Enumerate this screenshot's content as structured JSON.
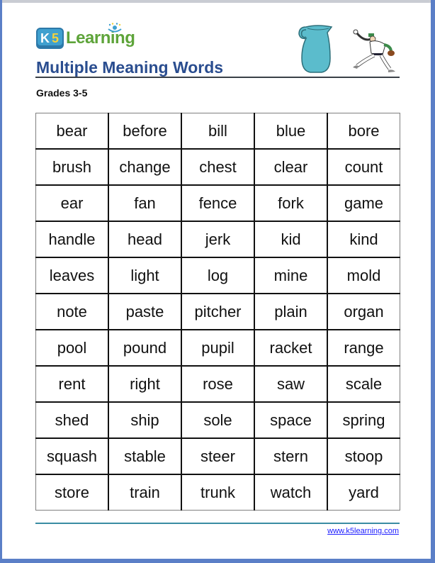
{
  "header": {
    "logo": {
      "badge_letters": "K",
      "badge_number": "5",
      "text": "Learning"
    },
    "title": "Multiple Meaning Words",
    "subtitle": "Grades 3-5",
    "illustrations": [
      "pitcher-jug-icon",
      "baseball-pitcher-icon"
    ]
  },
  "colors": {
    "title": "#2a4d8f",
    "logo_green": "#5ea43a",
    "logo_blue": "#3fa0cf",
    "pitcher_fill": "#5bbccc",
    "footer_rule": "#3a8ca3",
    "link": "#1a1aff",
    "frame": "#5b7fc7"
  },
  "word_grid": [
    [
      "bear",
      "before",
      "bill",
      "blue",
      "bore"
    ],
    [
      "brush",
      "change",
      "chest",
      "clear",
      "count"
    ],
    [
      "ear",
      "fan",
      "fence",
      "fork",
      "game"
    ],
    [
      "handle",
      "head",
      "jerk",
      "kid",
      "kind"
    ],
    [
      "leaves",
      "light",
      "log",
      "mine",
      "mold"
    ],
    [
      "note",
      "paste",
      "pitcher",
      "plain",
      "organ"
    ],
    [
      "pool",
      "pound",
      "pupil",
      "racket",
      "range"
    ],
    [
      "rent",
      "right",
      "rose",
      "saw",
      "scale"
    ],
    [
      "shed",
      "ship",
      "sole",
      "space",
      "spring"
    ],
    [
      "squash",
      "stable",
      "steer",
      "stern",
      "stoop"
    ],
    [
      "store",
      "train",
      "trunk",
      "watch",
      "yard"
    ]
  ],
  "footer": {
    "link_text": "www.k5learning.com"
  }
}
